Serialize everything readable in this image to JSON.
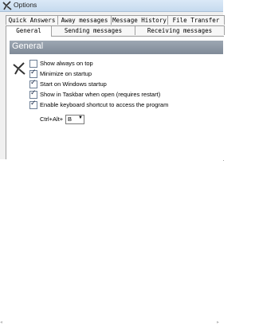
{
  "window": {
    "title": "Options",
    "tabs_row1": [
      "Quick Answers",
      "Away messages",
      "Message History",
      "File Transfer"
    ],
    "tabs_row2": [
      "General",
      "Sending messages",
      "Receiving messages"
    ],
    "active_tab": "General"
  },
  "general": {
    "section_title": "General",
    "options": [
      {
        "label": "Show always on top",
        "checked": false
      },
      {
        "label": "Minimize on startup",
        "checked": true
      },
      {
        "label": "Start on Windows startup",
        "checked": true
      },
      {
        "label": "Show in Taskbar when open (requires restart)",
        "checked": true
      },
      {
        "label": "Enable keyboard shortcut to access the program",
        "checked": true
      }
    ],
    "shortcut_label": "Ctrl+Alt+",
    "shortcut_value": "B"
  }
}
